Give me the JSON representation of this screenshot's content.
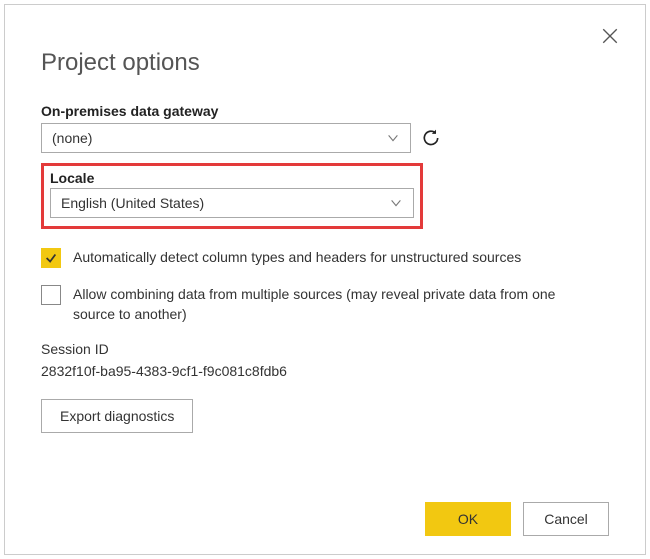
{
  "dialog": {
    "title": "Project options",
    "close_icon": "close"
  },
  "gateway": {
    "label": "On-premises data gateway",
    "value": "(none)",
    "refresh_icon": "refresh"
  },
  "locale": {
    "label": "Locale",
    "value": "English (United States)"
  },
  "options": {
    "auto_detect": {
      "label": "Automatically detect column types and headers for unstructured sources",
      "checked": true
    },
    "allow_combine": {
      "label": "Allow combining data from multiple sources (may reveal private data from one source to another)",
      "checked": false
    }
  },
  "session": {
    "label": "Session ID",
    "value": "2832f10f-ba95-4383-9cf1-f9c081c8fdb6"
  },
  "buttons": {
    "export_diagnostics": "Export diagnostics",
    "ok": "OK",
    "cancel": "Cancel"
  }
}
